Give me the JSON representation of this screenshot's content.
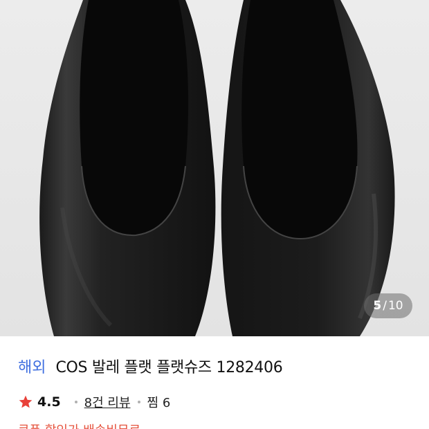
{
  "gallery": {
    "current": "5",
    "separator": "/",
    "total": "10",
    "image_subject": "black-leather-ballet-flats"
  },
  "product": {
    "badge": "해외",
    "title": "COS 발레 플랫 플랫슈즈 1282406",
    "rating": "4.5",
    "reviews_label": "8건 리뷰",
    "wishlist_label": "찜 6",
    "promo_text": "쿠폰 할인가 배송비무료"
  },
  "colors": {
    "badge": "#3f6fe0",
    "star": "#e8413a",
    "promo": "#e5533d",
    "image_background": "#e6e6e6",
    "shoe": "#141414"
  }
}
